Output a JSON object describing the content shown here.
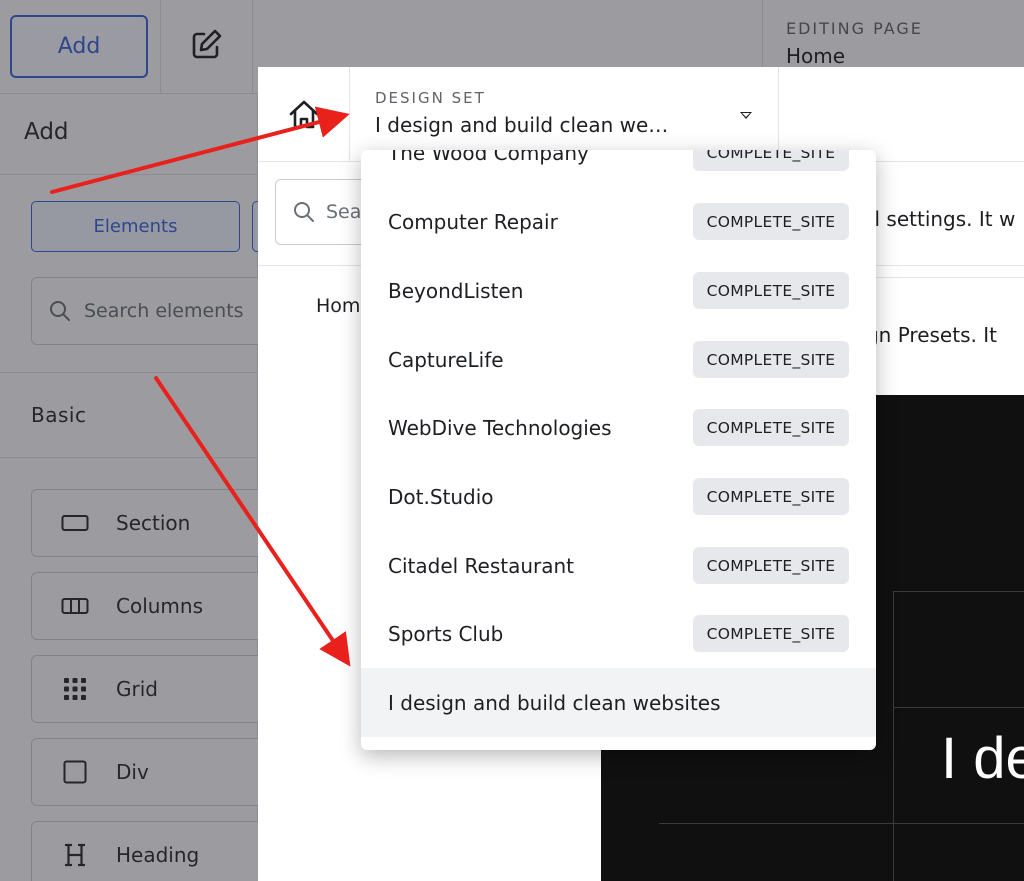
{
  "editor": {
    "add_button": "Add",
    "editing_caption": "EDITING PAGE",
    "editing_page": "Home",
    "panel_title": "Add",
    "tab_elements": "Elements",
    "search_placeholder": "Search elements",
    "basic_label": "Basic",
    "elements": [
      {
        "label": "Section",
        "icon": "section-icon"
      },
      {
        "label": "Columns",
        "icon": "columns-icon"
      },
      {
        "label": "Grid",
        "icon": "grid-icon"
      },
      {
        "label": "Div",
        "icon": "div-icon"
      },
      {
        "label": "Heading",
        "icon": "heading-icon"
      }
    ]
  },
  "modal": {
    "design_set_caption": "DESIGN SET",
    "design_set_value": "I design and build clean we…",
    "search_placeholder": "Sea",
    "home_link": "Hom",
    "info_text_1": "oal settings. It w",
    "info_text_2": "sign Presets. It",
    "preview_text": "I de"
  },
  "dropdown": {
    "items": [
      {
        "name": "The Wood Company",
        "badge": "COMPLETE_SITE"
      },
      {
        "name": "Computer Repair",
        "badge": "COMPLETE_SITE"
      },
      {
        "name": "BeyondListen",
        "badge": "COMPLETE_SITE"
      },
      {
        "name": "CaptureLife",
        "badge": "COMPLETE_SITE"
      },
      {
        "name": "WebDive Technologies",
        "badge": "COMPLETE_SITE"
      },
      {
        "name": "Dot.Studio",
        "badge": "COMPLETE_SITE"
      },
      {
        "name": "Citadel Restaurant",
        "badge": "COMPLETE_SITE"
      },
      {
        "name": "Sports Club",
        "badge": "COMPLETE_SITE"
      },
      {
        "name": "I design and build clean websites",
        "badge": ""
      }
    ],
    "selected_index": 8
  },
  "colors": {
    "accent": "#3b62d8",
    "annotation_arrow": "#e8211d"
  }
}
